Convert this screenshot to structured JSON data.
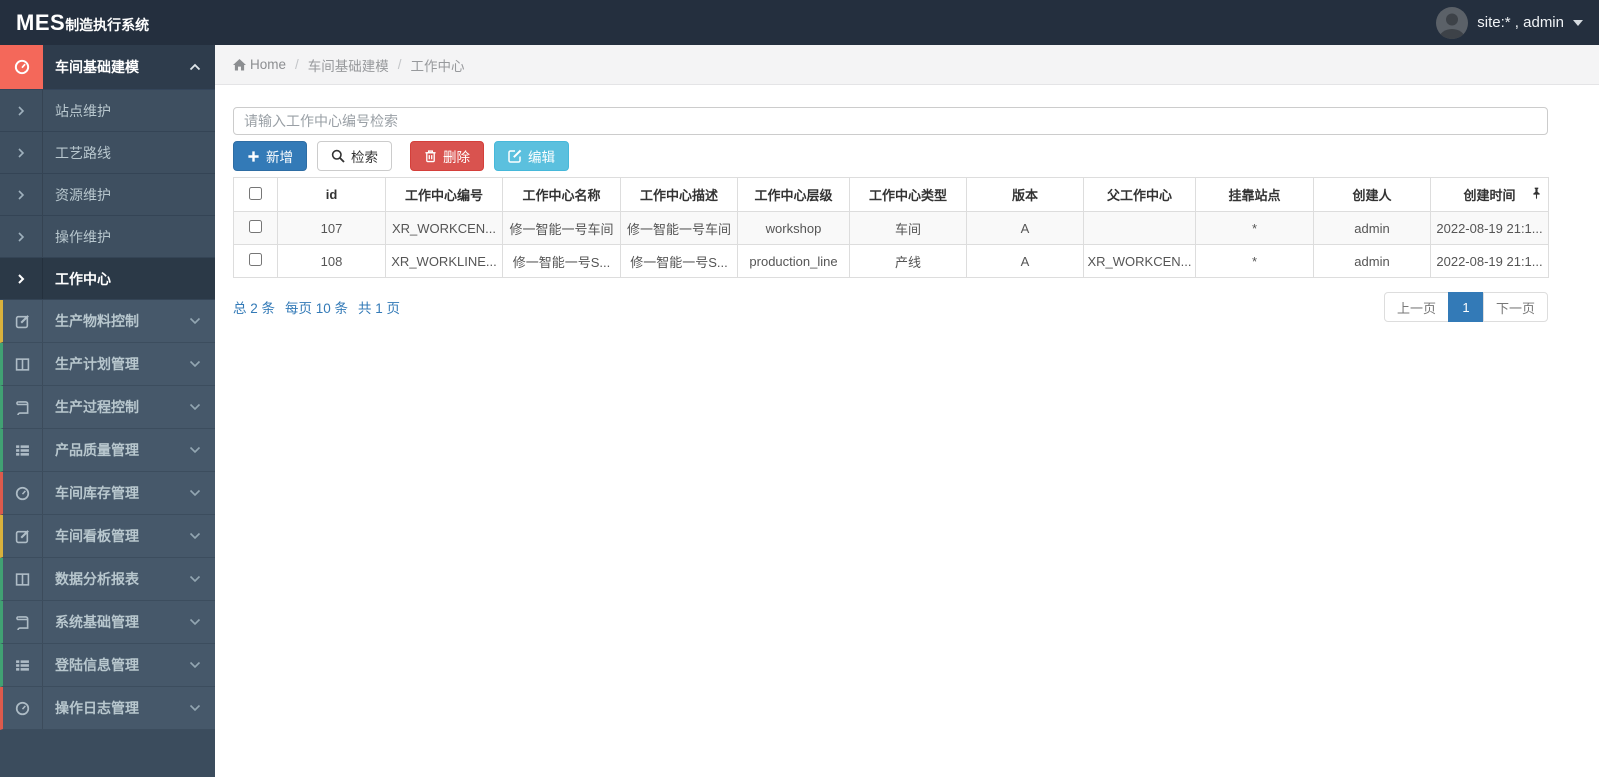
{
  "navbar": {
    "logo_bold": "MES",
    "logo_rest": "制造执行系统",
    "user_label": "site:* , admin"
  },
  "breadcrumb": {
    "home": "Home",
    "sep1": "/",
    "level1": "车间基础建模",
    "sep2": "/",
    "level2": "工作中心"
  },
  "sidebar": {
    "active_group": {
      "label": "车间基础建模",
      "icon": "gauge-icon",
      "icon_bg": "#f4685a"
    },
    "submenu": [
      {
        "label": "站点维护",
        "active": false
      },
      {
        "label": "工艺路线",
        "active": false
      },
      {
        "label": "资源维护",
        "active": false
      },
      {
        "label": "操作维护",
        "active": false
      },
      {
        "label": "工作中心",
        "active": true
      }
    ],
    "groups": [
      {
        "label": "生产物料控制",
        "icon": "edit-icon",
        "accent": "#d9b13c"
      },
      {
        "label": "生产计划管理",
        "icon": "columns-icon",
        "accent": "#41a173"
      },
      {
        "label": "生产过程控制",
        "icon": "book-icon",
        "accent": "#41a173"
      },
      {
        "label": "产品质量管理",
        "icon": "list-icon",
        "accent": "#41a173"
      },
      {
        "label": "车间库存管理",
        "icon": "gauge-icon",
        "accent": "#dd5a4c"
      },
      {
        "label": "车间看板管理",
        "icon": "edit-icon",
        "accent": "#d9b13c"
      },
      {
        "label": "数据分析报表",
        "icon": "columns-icon",
        "accent": "#41a173"
      },
      {
        "label": "系统基础管理",
        "icon": "book-icon",
        "accent": "#41a173"
      },
      {
        "label": "登陆信息管理",
        "icon": "list-icon",
        "accent": "#41a173"
      },
      {
        "label": "操作日志管理",
        "icon": "gauge-icon",
        "accent": "#dd5a4c"
      }
    ]
  },
  "toolbar": {
    "search_placeholder": "请输入工作中心编号检索",
    "add_label": "新增",
    "search_label": "检索",
    "delete_label": "删除",
    "edit_label": "编辑"
  },
  "table": {
    "columns": [
      "id",
      "工作中心编号",
      "工作中心名称",
      "工作中心描述",
      "工作中心层级",
      "工作中心类型",
      "版本",
      "父工作中心",
      "挂靠站点",
      "创建人",
      "创建时间"
    ],
    "rows": [
      {
        "id": "107",
        "code": "XR_WORKCEN...",
        "name": "修一智能一号车间",
        "desc": "修一智能一号车间",
        "level": "workshop",
        "type": "车间",
        "version": "A",
        "parent": "",
        "station": "*",
        "creator": "admin",
        "created": "2022-08-19 21:1..."
      },
      {
        "id": "108",
        "code": "XR_WORKLINE...",
        "name": "修一智能一号S...",
        "desc": "修一智能一号S...",
        "level": "production_line",
        "type": "产线",
        "version": "A",
        "parent": "XR_WORKCEN...",
        "station": "*",
        "creator": "admin",
        "created": "2022-08-19 21:1..."
      }
    ]
  },
  "pagination": {
    "summary_total": "总 2 条",
    "summary_per_page": "每页 10 条",
    "summary_pages": "共 1 页",
    "prev": "上一页",
    "page": "1",
    "next": "下一页"
  },
  "colors": {
    "navbar_bg": "#242f3e",
    "sidebar_bg": "#3b4c5d",
    "sidebar_item_bg": "#46586a",
    "active_icon_salmon": "#f4685a",
    "accent_blue": "#337ab7",
    "danger_red": "#d9534f",
    "info_cyan": "#5bc0de",
    "accent_yellow": "#d9b13c",
    "accent_green": "#41a173",
    "accent_red": "#dd5a4c"
  }
}
